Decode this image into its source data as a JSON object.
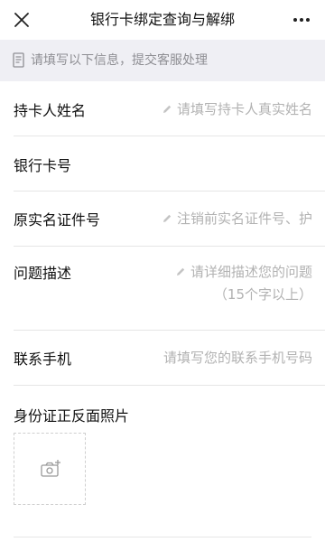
{
  "header": {
    "title": "银行卡绑定查询与解绑"
  },
  "notice": {
    "text": "请填写以下信息，提交客服处理"
  },
  "form": {
    "name": {
      "label": "持卡人姓名",
      "placeholder": "请填写持卡人真实姓名"
    },
    "card": {
      "label": "银行卡号"
    },
    "id": {
      "label": "原实名证件号",
      "placeholder": "注销前实名证件号、护"
    },
    "issue": {
      "label": "问题描述",
      "placeholder_line1": "请详细描述您的问题",
      "placeholder_line2": "（15个字以上）"
    },
    "phone": {
      "label": "联系手机",
      "placeholder": "请填写您的联系手机号码"
    },
    "photo": {
      "label": "身份证正反面照片"
    }
  }
}
